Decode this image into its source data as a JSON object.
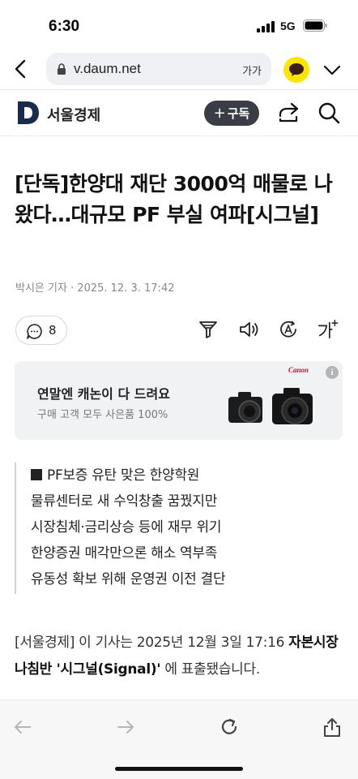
{
  "status_bar": {
    "time": "6:30",
    "network": "5G"
  },
  "browser": {
    "url": "v.daum.net",
    "font_size_label": "가가",
    "icons": [
      "back-arrow-icon",
      "lock-icon",
      "kakaotalk-icon",
      "chevron-down-icon"
    ]
  },
  "site": {
    "name": "서울경제",
    "subscribe_label": "구독",
    "icons": [
      "daum-logo",
      "share-icon",
      "search-icon"
    ]
  },
  "article": {
    "headline": "[단독]한양대 재단 3000억 매물로 나왔다…대규모 PF 부실 여파[시그널]",
    "byline": "박시은 기자 · 2025. 12. 3. 17:42",
    "comment_count": "8",
    "toolbar_icons": [
      "summary-icon",
      "speaker-icon",
      "translate-icon",
      "font-size-icon"
    ],
    "summary": [
      "PF보증 유탄 맞은 한양학원",
      "물류센터로 새 수익창출 꿈꿨지만",
      "시장침체·금리상승 등에 재무 위기",
      "한양증권 매각만으론 해소 역부족",
      "유동성 확보 위해 운영권 이전 결단"
    ],
    "body_prefix": "[서울경제] 이 기사는 2025년 12월 3일 17:16 ",
    "body_bold": "자본시장 나침반  '시그널(Signal)'",
    "body_suffix": " 에 표출됐습니다."
  },
  "ad": {
    "title": "연말엔 캐논이 다 드려요",
    "subtitle": "구매 고객 모두 사은품 100%",
    "brand": "Canon",
    "info": "i"
  },
  "bottom_bar": {
    "icons": [
      "back-icon",
      "forward-icon",
      "reload-icon",
      "share-upload-icon"
    ]
  }
}
